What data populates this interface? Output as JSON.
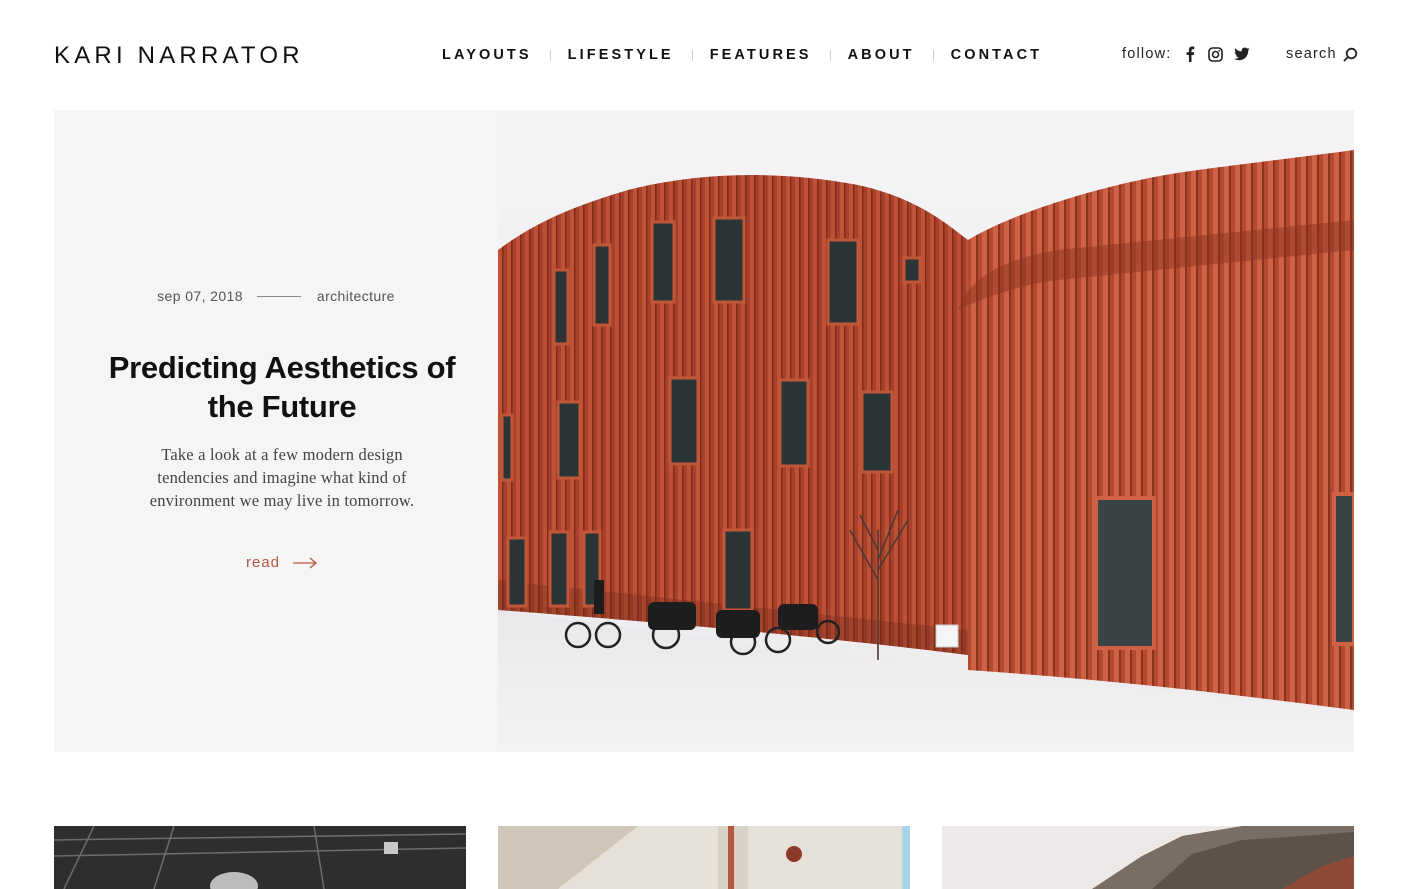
{
  "header": {
    "logo": "KARI NARRATOR",
    "nav": [
      "LAYOUTS",
      "LIFESTYLE",
      "FEATURES",
      "ABOUT",
      "CONTACT"
    ],
    "follow_label": "follow:",
    "social": [
      "facebook-icon",
      "instagram-icon",
      "twitter-icon"
    ],
    "search_label": "search"
  },
  "hero": {
    "date": "sep 07, 2018",
    "category": "architecture",
    "title": "Predicting Aesthetics of the Future",
    "excerpt": "Take a look at a few modern design tendencies and imagine what kind of environment we may live in tomorrow.",
    "read_label": "read",
    "accent_color": "#b5583f",
    "image": "red slatted curved building"
  },
  "cards": [
    {
      "image": "dark ceiling interior"
    },
    {
      "image": "beige wall with lamp"
    },
    {
      "image": "rocky mountain"
    }
  ]
}
